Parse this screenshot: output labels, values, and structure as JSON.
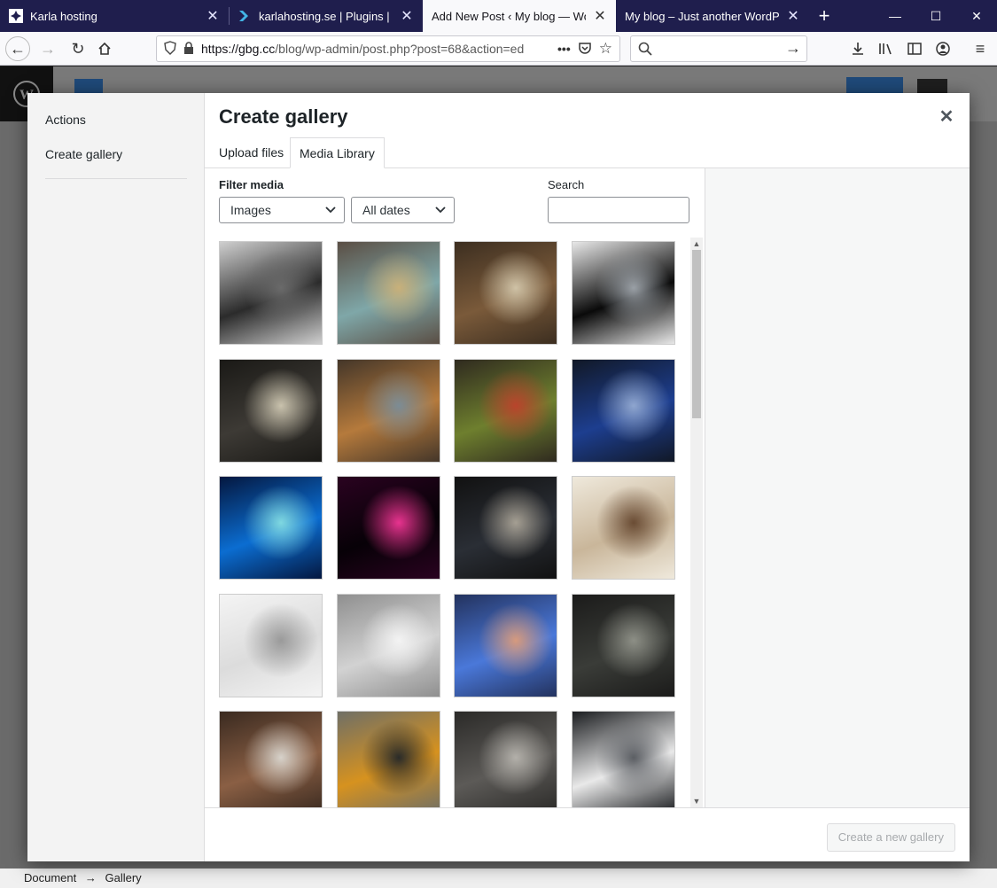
{
  "browser": {
    "tabs": [
      {
        "title": "Karla hosting",
        "active": false
      },
      {
        "title": "karlahosting.se | Plugins | Dire",
        "active": false
      },
      {
        "title": "Add New Post ‹ My blog — Wordl",
        "active": true
      },
      {
        "title": "My blog – Just another WordPress",
        "active": false
      }
    ],
    "url_host": "https://gbg.cc",
    "url_path": "/blog/wp-admin/post.php?post=68&action=ed",
    "accent": "#1f1e4d"
  },
  "modal": {
    "menu": {
      "actions": "Actions",
      "create_gallery": "Create gallery"
    },
    "title": "Create gallery",
    "tabs": {
      "upload": "Upload files",
      "library": "Media Library"
    },
    "filter_label": "Filter media",
    "filter_type": "Images",
    "filter_date": "All dates",
    "search_label": "Search",
    "search_value": "",
    "create_button": "Create a new gallery"
  },
  "media_items": [
    {
      "name": "vintage-car",
      "c1": "#2b2b2b",
      "c2": "#6a6a6a",
      "c3": "#cfcfcf"
    },
    {
      "name": "globe-city",
      "c1": "#7fa7a8",
      "c2": "#c8b07a",
      "c3": "#5a4e44"
    },
    {
      "name": "binoculars",
      "c1": "#7a5a3a",
      "c2": "#cfc2a6",
      "c3": "#3c2e20"
    },
    {
      "name": "gauges",
      "c1": "#0a0a0a",
      "c2": "#9aa0a6",
      "c3": "#e8e8e8"
    },
    {
      "name": "barrels",
      "c1": "#3d3a35",
      "c2": "#c9c2ad",
      "c3": "#1a1916"
    },
    {
      "name": "street",
      "c1": "#b57a3c",
      "c2": "#7c8c95",
      "c3": "#443629"
    },
    {
      "name": "motorbike-garden",
      "c1": "#6e7f2e",
      "c2": "#b9442c",
      "c3": "#2f2a1f"
    },
    {
      "name": "engine",
      "c1": "#1d3e8f",
      "c2": "#8fa6cf",
      "c3": "#111826"
    },
    {
      "name": "mannequins",
      "c1": "#0b6dd1",
      "c2": "#7fd8e0",
      "c3": "#04173f"
    },
    {
      "name": "neon-love",
      "c1": "#070107",
      "c2": "#e8338f",
      "c3": "#2a0320"
    },
    {
      "name": "gas-mask",
      "c1": "#2a2e35",
      "c2": "#a59f93",
      "c3": "#111"
    },
    {
      "name": "wrecked-car",
      "c1": "#c9b69a",
      "c2": "#6a4c34",
      "c3": "#efe9dc"
    },
    {
      "name": "bride",
      "c1": "#dcdcdc",
      "c2": "#9a9a9a",
      "c3": "#f4f4f4"
    },
    {
      "name": "white-face",
      "c1": "#d2d2d2",
      "c2": "#f3f3f3",
      "c3": "#8f8f8f"
    },
    {
      "name": "woman-butterflies",
      "c1": "#4a78d9",
      "c2": "#d69a7e",
      "c3": "#23325e"
    },
    {
      "name": "band",
      "c1": "#3a3c38",
      "c2": "#8d8f86",
      "c3": "#1b1b1a"
    },
    {
      "name": "tractor",
      "c1": "#8a5f44",
      "c2": "#d7d2ca",
      "c3": "#3a2a20"
    },
    {
      "name": "machine",
      "c1": "#d6921f",
      "c2": "#2a2b29",
      "c3": "#6f6f66"
    },
    {
      "name": "boombox",
      "c1": "#5c5a57",
      "c2": "#b3b0aa",
      "c3": "#2b2a28"
    },
    {
      "name": "stormtrooper",
      "c1": "#e9e9e9",
      "c2": "#5b5e63",
      "c3": "#1b1d20"
    }
  ],
  "status_bar": {
    "document": "Document",
    "arrow": "→",
    "block": "Gallery"
  }
}
